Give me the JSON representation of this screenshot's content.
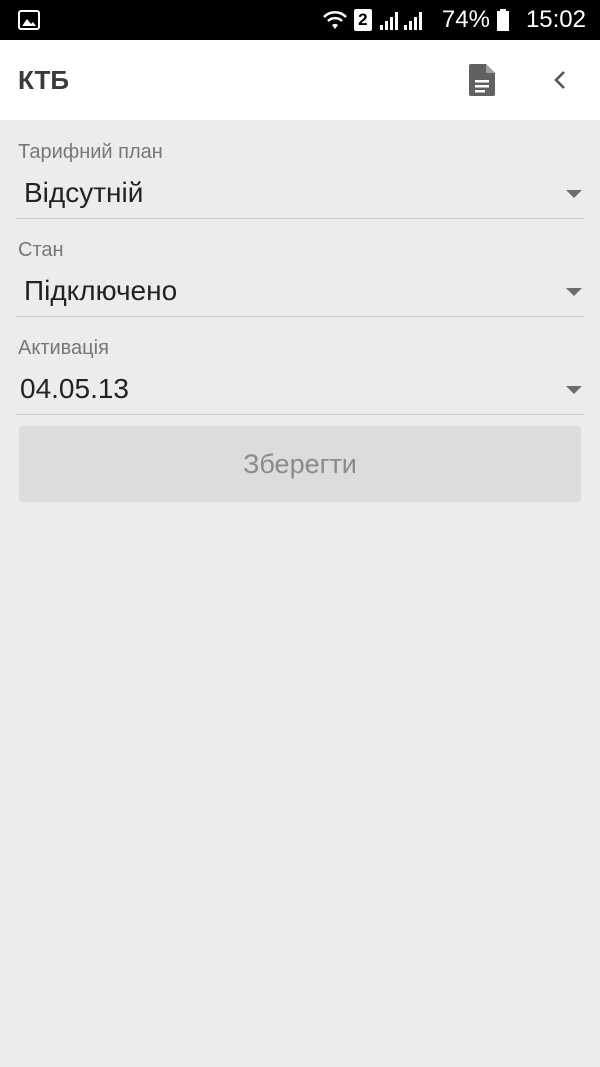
{
  "status_bar": {
    "sim_slot": "2",
    "battery": "74%",
    "time": "15:02"
  },
  "app_bar": {
    "title": "КТБ",
    "icons": [
      "document-icon",
      "back-chevron-icon"
    ]
  },
  "form": {
    "tariff": {
      "label": "Тарифний план",
      "value": "Відсутній"
    },
    "state": {
      "label": "Стан",
      "value": "Підключено"
    },
    "activation": {
      "label": "Активація",
      "value": "04.05.13"
    },
    "save_label": "Зберегти"
  },
  "colors": {
    "status_bar_bg": "#000000",
    "app_bar_bg": "#ffffff",
    "page_bg": "#ececec",
    "button_bg": "#dcdcdc",
    "button_text": "#8a8a8a"
  }
}
